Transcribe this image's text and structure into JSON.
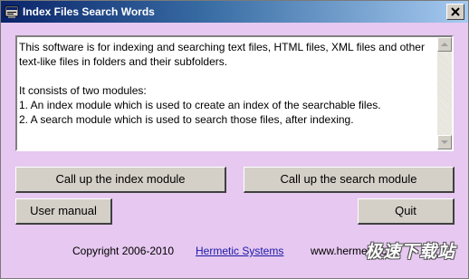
{
  "window": {
    "title": "Index Files Search Words"
  },
  "description": {
    "text": "This software is for indexing and searching text files, HTML files, XML files and other text-like files in folders and their subfolders.\n\nIt consists of two modules:\n1. An index module which is used to create an index of the searchable files.\n2. A search module which is used to search those files, after indexing."
  },
  "buttons": {
    "index_module": "Call up the index module",
    "search_module": "Call up the search module",
    "user_manual": "User manual",
    "quit": "Quit"
  },
  "footer": {
    "copyright": "Copyright 2006-2010",
    "company_link": "Hermetic Systems",
    "website": "www.hermetic.ch"
  },
  "watermark": {
    "text": "极速下载站"
  },
  "colors": {
    "background": "#E6C8F0",
    "titlebar_start": "#0a246a",
    "titlebar_end": "#a6caf0",
    "button_face": "#d4d0c8",
    "link": "#1a1aa6"
  },
  "icons": {
    "app": "window-app-icon",
    "close": "close-icon",
    "scroll_up": "arrow-up-icon",
    "scroll_down": "arrow-down-icon"
  }
}
